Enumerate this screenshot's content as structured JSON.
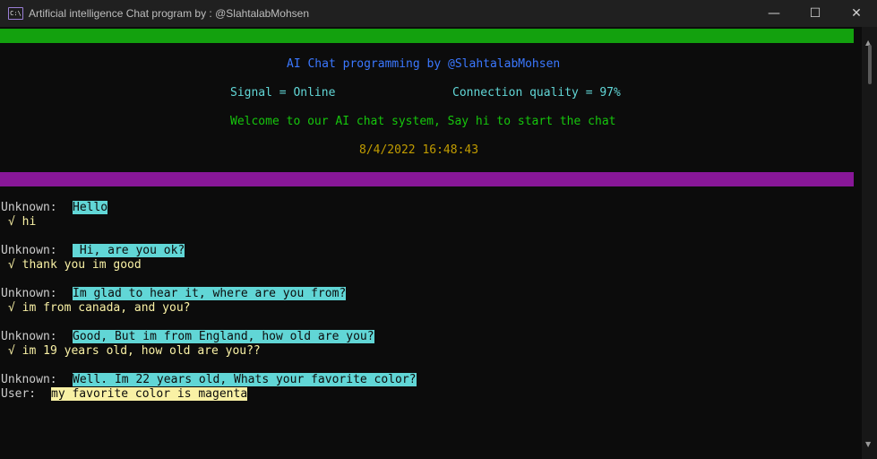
{
  "window": {
    "icon": "console-icon",
    "icon_text": "C:\\",
    "title": "Artificial intelligence Chat program by : @SlahtalabMohsen",
    "minimize_glyph": "—",
    "maximize_glyph": "☐",
    "close_glyph": "✕"
  },
  "header": {
    "title": "AI Chat programming by @SlahtalabMohsen",
    "signal": "Signal = Online",
    "connection_quality": "Connection quality = 97%",
    "welcome": "Welcome to our AI chat system, Say hi to start the chat",
    "datetime": "8/4/2022 16:48:43"
  },
  "colors": {
    "green_bar": "#13a10e",
    "purple_bar": "#881798",
    "title_blue": "#3b78ff",
    "text_cyan": "#61d6d6",
    "text_green": "#16c60c",
    "text_gold": "#c19c00",
    "text_yellow": "#f9f1a5",
    "highlight_cyan": "#61d6d6",
    "highlight_yellow": "#f9f1a5"
  },
  "chat": {
    "bot_label": "Unknown:",
    "user_label": "User:",
    "exchanges": [
      {
        "bot": "Hello",
        "reply": "√ hi"
      },
      {
        "bot": " Hi, are you ok?",
        "reply": "√ thank you im good"
      },
      {
        "bot": "Im glad to hear it, where are you from?",
        "reply": "√ im from canada, and you?"
      },
      {
        "bot": "Good, But im from England, how old are you?",
        "reply": "√ im 19 years old, how old are you??"
      },
      {
        "bot": "Well. Im 22 years old, Whats your favorite color?"
      }
    ],
    "current_input": "my favorite color is magenta"
  }
}
